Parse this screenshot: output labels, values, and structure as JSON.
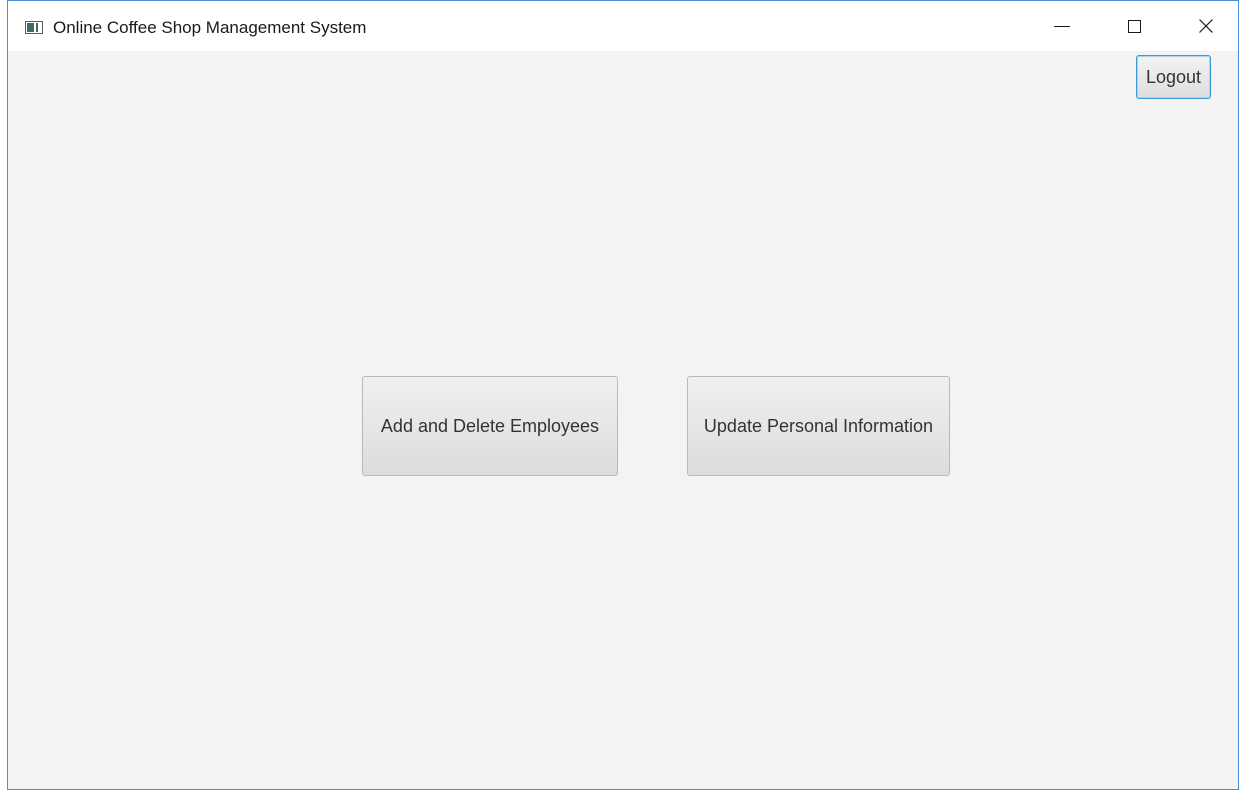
{
  "window": {
    "title": "Online Coffee Shop Management System",
    "icon": "app-window-icon",
    "controls": [
      "minimize-icon",
      "maximize-icon",
      "close-icon"
    ]
  },
  "toolbar": {
    "logout_label": "Logout"
  },
  "main": {
    "add_delete_label": "Add and Delete Employees",
    "update_info_label": "Update Personal Information"
  },
  "colors": {
    "window_border": "#4a8fd6",
    "background": "#f3f3f3",
    "focus_accent": "#3a9ad9"
  }
}
